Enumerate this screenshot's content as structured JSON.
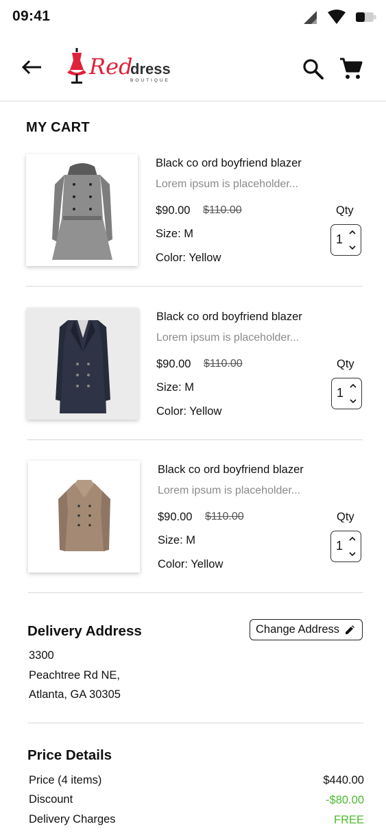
{
  "status_bar": {
    "time": "09:41",
    "icons": [
      "signal-icon",
      "wifi-icon",
      "battery-icon"
    ]
  },
  "header": {
    "back_icon": "arrow-left-icon",
    "logo": {
      "word1": "Red",
      "word2": "dress",
      "word3": "BOUTIQUE"
    },
    "search_icon": "search-icon",
    "cart_icon": "shopping-cart-icon"
  },
  "cart": {
    "title": "MY CART",
    "items": [
      {
        "name": "Black co ord  boyfriend blazer",
        "description": "Lorem ipsum is placeholder...",
        "price": "$90.00",
        "old_price": "$110.00",
        "size": "Size: M",
        "color": "Color: Yellow",
        "qty_label": "Qty",
        "qty": "1",
        "image": "grey-peacoat-image"
      },
      {
        "name": "Black co ord  boyfriend blazer",
        "description": "Lorem ipsum is placeholder...",
        "price": "$90.00",
        "old_price": "$110.00",
        "size": "Size: M",
        "color": "Color: Yellow",
        "qty_label": "Qty",
        "qty": "1",
        "image": "navy-blazer-image"
      },
      {
        "name": "Black co ord  boyfriend blazer",
        "description": "Lorem ipsum is placeholder...",
        "price": "$90.00",
        "old_price": "$110.00",
        "size": "Size: M",
        "color": "Color: Yellow",
        "qty_label": "Qty",
        "qty": "1",
        "image": "tan-jacket-image"
      }
    ]
  },
  "delivery": {
    "heading": "Delivery Address",
    "change_button": "Change Address",
    "address_lines": [
      "3300",
      "Peachtree Rd NE,",
      "Atlanta, GA 30305"
    ]
  },
  "price_details": {
    "heading": "Price Details",
    "rows": [
      {
        "label": "Price (4 items)",
        "value": "$440.00"
      },
      {
        "label": "Discount",
        "value": "-$80.00"
      },
      {
        "label": "Delivery Charges",
        "value": "FREE"
      }
    ]
  },
  "colors": {
    "brand_red": "#e0213a",
    "accent_green": "#4cbb2e",
    "divider": "#d8d8d8"
  }
}
